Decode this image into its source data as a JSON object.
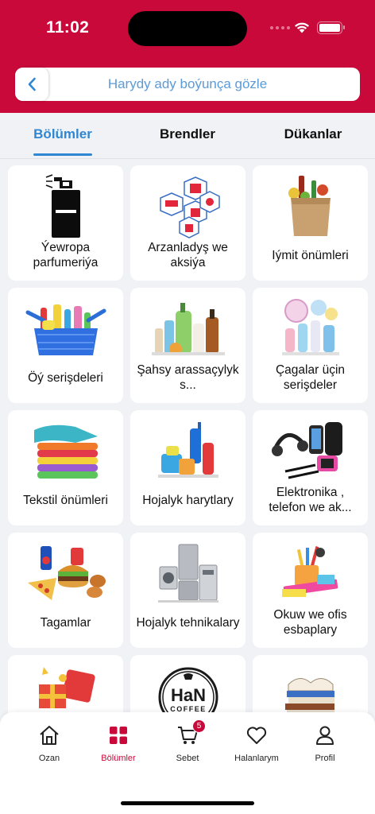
{
  "status_bar": {
    "time": "11:02"
  },
  "search": {
    "placeholder": "Harydy ady boýunça gözle"
  },
  "tabs": [
    {
      "label": "Bölümler",
      "active": true
    },
    {
      "label": "Brendler",
      "active": false
    },
    {
      "label": "Dükanlar",
      "active": false
    }
  ],
  "categories": [
    {
      "label": "Ýewropa parfumeriýa",
      "icon": "perfume-icon"
    },
    {
      "label": "Arzanladyş we aksiýa",
      "icon": "discount-icon"
    },
    {
      "label": "Iýmit önümleri",
      "icon": "grocery-bag-icon"
    },
    {
      "label": "Öý serişdeleri",
      "icon": "cleaning-basket-icon"
    },
    {
      "label": "Şahsy arassaçylyk s...",
      "icon": "hygiene-bottles-icon"
    },
    {
      "label": "Çagalar üçin serişdeler",
      "icon": "baby-products-icon"
    },
    {
      "label": "Tekstil önümleri",
      "icon": "towels-icon"
    },
    {
      "label": "Hojalyk harytlary",
      "icon": "household-goods-icon"
    },
    {
      "label": "Elektronika , telefon we ak...",
      "icon": "electronics-icon"
    },
    {
      "label": "Tagamlar",
      "icon": "fast-food-icon"
    },
    {
      "label": "Hojalyk tehnikalary",
      "icon": "appliances-icon"
    },
    {
      "label": "Okuw we ofis esbaplary",
      "icon": "stationery-icon"
    },
    {
      "label": "",
      "icon": "gift-icon"
    },
    {
      "label": "",
      "icon": "han-coffee-logo"
    },
    {
      "label": "",
      "icon": "books-icon"
    }
  ],
  "tabbar": {
    "items": [
      {
        "label": "Ozan",
        "icon": "home-icon"
      },
      {
        "label": "Bölümler",
        "icon": "grid-icon",
        "active": true
      },
      {
        "label": "Sebet",
        "icon": "cart-icon",
        "badge": "5"
      },
      {
        "label": "Halanlarym",
        "icon": "heart-icon"
      },
      {
        "label": "Profil",
        "icon": "profile-icon"
      }
    ]
  },
  "logo_text": {
    "line1": "HaN",
    "line2": "COFFEE"
  },
  "colors": {
    "brand": "#c8093a",
    "accent": "#2f86d3",
    "background": "#f1f2f6"
  }
}
